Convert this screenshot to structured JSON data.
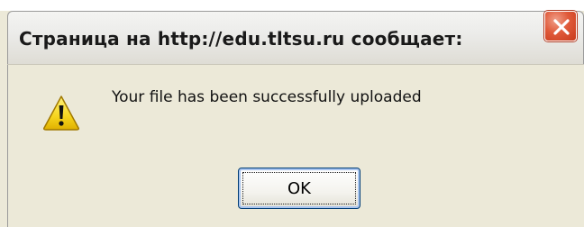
{
  "dialog": {
    "title": "Страница на http://edu.tltsu.ru сообщает:",
    "message": "Your file has been successfully uploaded",
    "ok_label": "OK",
    "icon": "warning-icon",
    "colors": {
      "background": "#ece9d8",
      "close_button": "#e05a3a",
      "warning_fill": "#f6d51e",
      "button_border": "#003c74"
    }
  }
}
